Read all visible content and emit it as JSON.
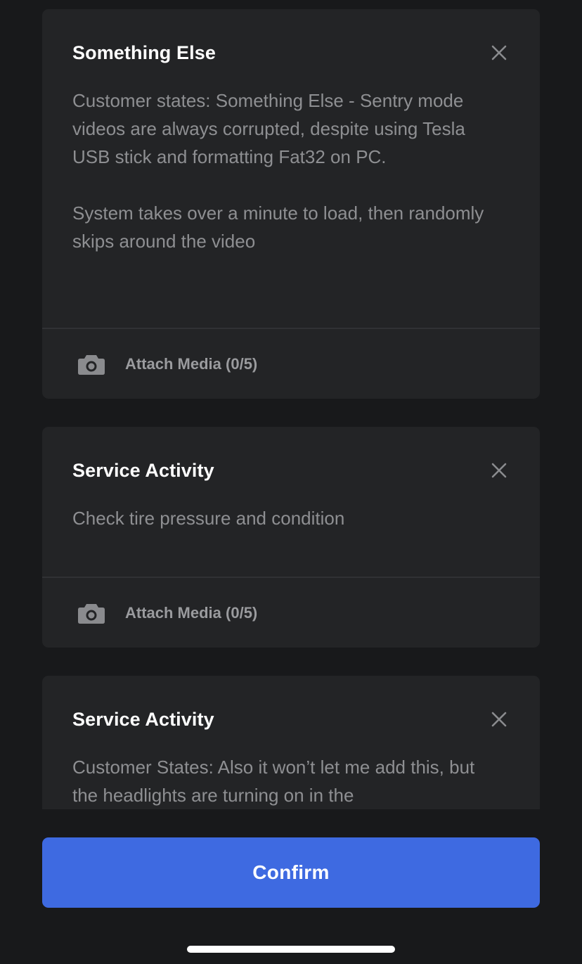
{
  "cards": [
    {
      "title": "Something Else",
      "body": "Customer states: Something Else - Sentry mode videos are always corrupted, despite using Tesla USB stick and formatting Fat32 on PC.\n\nSystem takes over a minute to load, then randomly skips around the video",
      "attach_label": "Attach Media (0/5)",
      "close_icon": "close-icon",
      "attach_icon": "camera-icon"
    },
    {
      "title": "Service Activity",
      "body": "Check tire pressure and condition",
      "attach_label": "Attach Media (0/5)",
      "close_icon": "close-icon",
      "attach_icon": "camera-icon"
    },
    {
      "title": "Service Activity",
      "body": "Customer States: Also it won’t let me add this, but the headlights are turning on in the",
      "close_icon": "close-icon"
    }
  ],
  "confirm": {
    "label": "Confirm"
  },
  "colors": {
    "background": "#18191b",
    "card": "#232426",
    "accent": "#3e6ae1",
    "muted_text": "#8e8f92"
  }
}
